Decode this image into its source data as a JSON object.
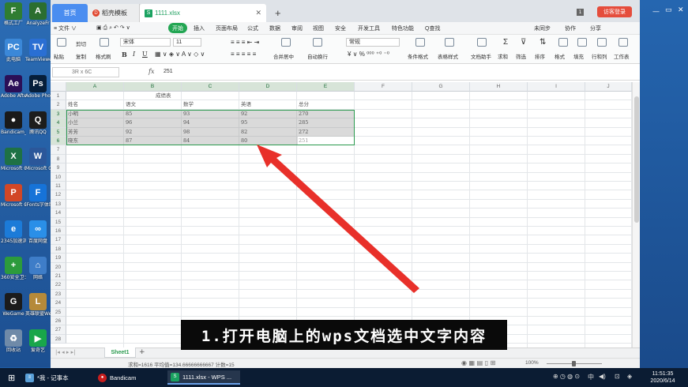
{
  "desktop_icons": [
    {
      "label": "格式工厂",
      "color": "#2f7d32",
      "glyph": "F"
    },
    {
      "label": "AnalyzeFr",
      "color": "#2b6e2f",
      "glyph": "A"
    },
    {
      "label": "此电脑",
      "color": "#3b88d8",
      "glyph": "PC"
    },
    {
      "label": "TeamViewer",
      "color": "#2a6fd3",
      "glyph": "TV"
    },
    {
      "label": "Adobe After Effects 2020",
      "color": "#2b0f57",
      "glyph": "Ae"
    },
    {
      "label": "Adobe Photosh",
      "color": "#061e3a",
      "glyph": "Ps"
    },
    {
      "label": "Bandicam_Portable",
      "color": "#1a1a1a",
      "glyph": "●"
    },
    {
      "label": "腾讯QQ",
      "color": "#1d1d1d",
      "glyph": "Q"
    },
    {
      "label": "Microsoft Office Exc",
      "color": "#1e7145",
      "glyph": "X"
    },
    {
      "label": "Microsoft Office Wo",
      "color": "#2b579a",
      "glyph": "W"
    },
    {
      "label": "Microsoft Office Po",
      "color": "#d24726",
      "glyph": "P"
    },
    {
      "label": "iFonts字体助手",
      "color": "#1673d8",
      "glyph": "F"
    },
    {
      "label": "2345加速浏览器",
      "color": "#1c7bd8",
      "glyph": "e"
    },
    {
      "label": "百度网盘",
      "color": "#2a8fe8",
      "glyph": "∞"
    },
    {
      "label": "360安全卫士",
      "color": "#2c9b3c",
      "glyph": "+"
    },
    {
      "label": "网络",
      "color": "#3e7dc8",
      "glyph": "⌂"
    },
    {
      "label": "WeGame",
      "color": "#1b1b1b",
      "glyph": "G"
    },
    {
      "label": "英雄联盟WeGame版",
      "color": "#b58a3a",
      "glyph": "L"
    },
    {
      "label": "回收站",
      "color": "#6f8aa8",
      "glyph": "♻"
    },
    {
      "label": "爱奇艺",
      "color": "#19a64a",
      "glyph": "▶"
    }
  ],
  "tabs": {
    "home": "首页",
    "template": "稻壳模板",
    "file": "1111.xlsx",
    "file_icon": "S",
    "template_icon": "D",
    "add": "+"
  },
  "title_right": {
    "badge": "1",
    "login": "访客登录"
  },
  "menus": [
    "≡ 文件 ∨",
    "开始",
    "插入",
    "页面布局",
    "公式",
    "数据",
    "审阅",
    "视图",
    "安全",
    "开发工具",
    "特色功能",
    "Q查找"
  ],
  "menu_right": [
    "未同步",
    "协作",
    "分享"
  ],
  "ribbon": {
    "paste": "粘贴",
    "cut": "剪切",
    "copy": "复制",
    "format_painter": "格式刷",
    "font_name": "宋体",
    "font_size": "11",
    "format_B": "B",
    "format_I": "I",
    "format_U": "U",
    "merge": "合并居中",
    "wrap": "自动换行",
    "number_format": "常规",
    "cond_format": "条件格式",
    "table_style": "表格样式",
    "doc_helper": "文档助手",
    "sum": "求和",
    "filter": "筛选",
    "sort": "排序",
    "format": "格式",
    "fill": "填充",
    "rowcol": "行和列",
    "sheet": "工作表"
  },
  "formula_bar": {
    "namebox": "3R x 6C",
    "fx": "fx",
    "value": "251"
  },
  "columns": [
    "A",
    "B",
    "C",
    "D",
    "E",
    "F",
    "G",
    "H",
    "I",
    "J"
  ],
  "rows": [
    "1",
    "2",
    "3",
    "4",
    "5",
    "6",
    "7",
    "8",
    "9",
    "10",
    "11",
    "12",
    "13",
    "14",
    "15",
    "16",
    "17",
    "18",
    "19",
    "20",
    "21",
    "22",
    "23",
    "24",
    "25",
    "26",
    "27",
    "28"
  ],
  "sheet": {
    "title": "成绩表",
    "headers": [
      "姓名",
      "语文",
      "数学",
      "英语",
      "总分"
    ],
    "data": [
      [
        "小明",
        "85",
        "93",
        "92",
        "270"
      ],
      [
        "小兰",
        "96",
        "94",
        "95",
        "285"
      ],
      [
        "芳芳",
        "92",
        "98",
        "82",
        "272"
      ],
      [
        "晓东",
        "87",
        "84",
        "80",
        "251"
      ]
    ]
  },
  "sheet_tab": "Sheet1",
  "sheet_add": "+",
  "status": {
    "text": "求和=1616  平均值=134.66666666667  计数=15",
    "zoom": "100%"
  },
  "caption": "1.打开电脑上的wps文档选中文字内容",
  "taskbar": {
    "items": [
      "*我 - 记事本",
      "Bandicam",
      "1111.xlsx - WPS ..."
    ],
    "lang": "中",
    "time": "11:51:35",
    "date": "2020/6/14"
  },
  "colors": {
    "accent_green": "#2a9a4e",
    "tab_blue": "#4a8df0",
    "login_red": "#e54d3c",
    "arrow_red": "#e8302a"
  }
}
